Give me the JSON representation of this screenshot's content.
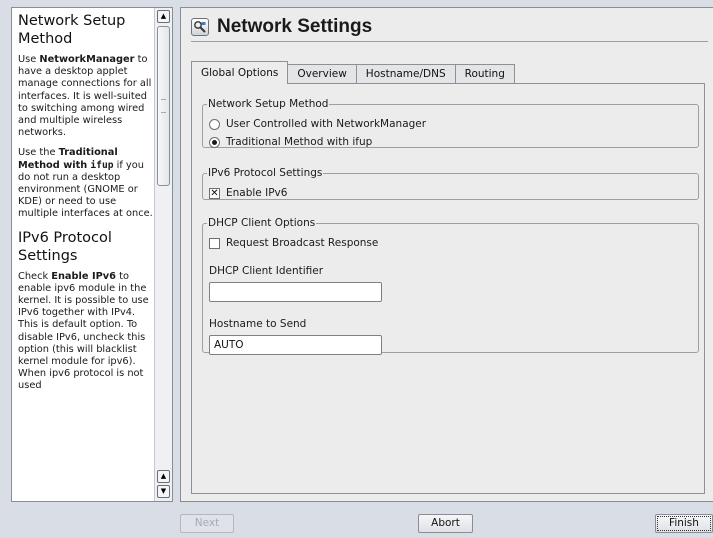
{
  "help": {
    "section1_title": "Network Setup Method",
    "p1_lead": "Use ",
    "p1_bold": "NetworkManager",
    "p1_rest": " to have a desktop applet manage connections for all interfaces. It is well-suited to switching among wired and multiple wireless networks.",
    "p2_lead": "Use the ",
    "p2_bold": "Traditional Method with",
    "p2_code": "ifup",
    "p2_rest": " if you do not run a desktop environment (GNOME or KDE) or need to use multiple interfaces at once.",
    "section2_title": "IPv6 Protocol Settings",
    "p3_lead": "Check ",
    "p3_bold": "Enable IPv6",
    "p3_rest": " to enable ipv6 module in the kernel. It is possible to use IPv6 together with IPv4. This is default option. To disable IPv6, uncheck this option (this will blacklist kernel module for ipv6). When ipv6 protocol is not used"
  },
  "header": {
    "title": "Network Settings",
    "icon": "network-settings-icon"
  },
  "tabs": [
    {
      "label": "Global Options",
      "active": true
    },
    {
      "label": "Overview",
      "active": false
    },
    {
      "label": "Hostname/DNS",
      "active": false
    },
    {
      "label": "Routing",
      "active": false
    }
  ],
  "setup_method": {
    "legend": "Network Setup Method",
    "option_user": "User Controlled with NetworkManager",
    "option_traditional": "Traditional Method with ifup",
    "selected": "traditional"
  },
  "ipv6": {
    "legend": "IPv6 Protocol Settings",
    "enable_label": "Enable IPv6",
    "enabled": true
  },
  "dhcp": {
    "legend": "DHCP Client Options",
    "broadcast_label": "Request Broadcast Response",
    "broadcast_checked": false,
    "identifier_label": "DHCP Client Identifier",
    "identifier_value": "",
    "hostname_label": "Hostname to Send",
    "hostname_value": "AUTO"
  },
  "buttons": {
    "next": "Next",
    "abort": "Abort",
    "finish": "Finish"
  }
}
